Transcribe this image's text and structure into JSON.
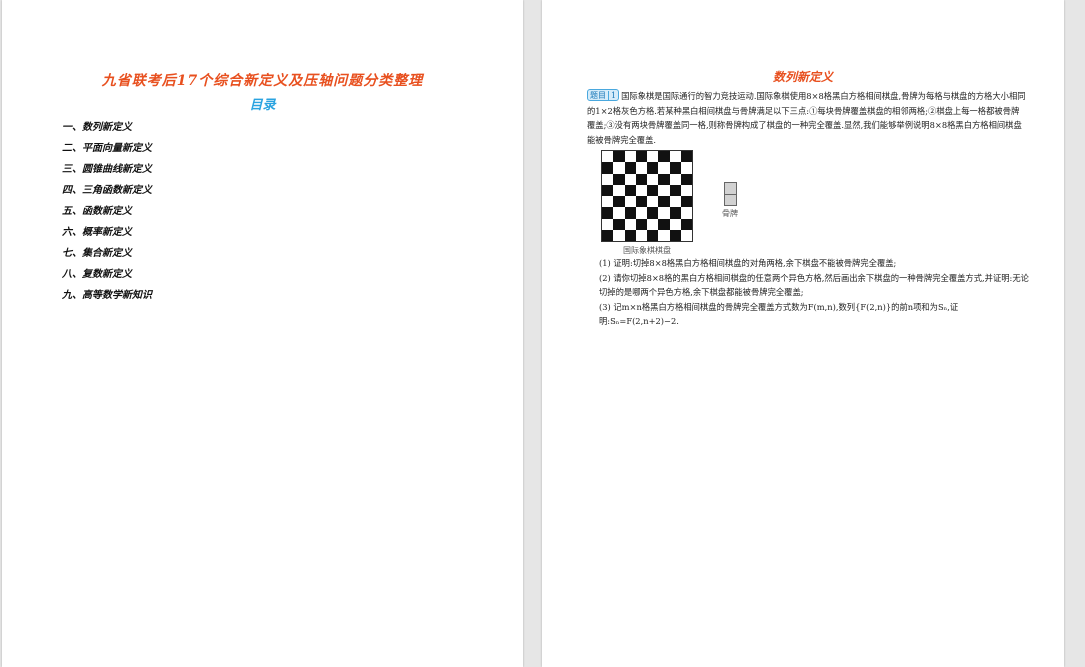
{
  "left_page": {
    "title": "九省联考后17个综合新定义及压轴问题分类整理",
    "toc_heading": "目录",
    "toc_items": [
      "一、数列新定义",
      "二、平面向量新定义",
      "三、圆锥曲线新定义",
      "四、三角函数新定义",
      "五、函数新定义",
      "六、概率新定义",
      "七、集合新定义",
      "八、复数新定义",
      "九、高等数学新知识"
    ]
  },
  "right_page": {
    "section_title": "数列新定义",
    "badge_label": "题目",
    "badge_number": "1",
    "problem_text": "国际象棋是国际通行的智力竞技运动.国际象棋使用8×8格黑白方格相间棋盘,骨牌为每格与棋盘的方格大小相同的1×2格灰色方格.若某种黑白相间棋盘与骨牌满足以下三点:①每块骨牌覆盖棋盘的相邻两格;②棋盘上每一格都被骨牌覆盖;③没有两块骨牌覆盖同一格,则称骨牌构成了棋盘的一种完全覆盖.显然,我们能够举例说明8×8格黑白方格相间棋盘能被骨牌完全覆盖.",
    "board_caption": "国际象棋棋盘",
    "domino_label": "骨牌",
    "questions": [
      "(1) 证明:切掉8×8格黑白方格相间棋盘的对角两格,余下棋盘不能被骨牌完全覆盖;",
      "(2) 请你切掉8×8格的黑白方格相间棋盘的任意两个异色方格,然后画出余下棋盘的一种骨牌完全覆盖方式,并证明:无论切掉的是哪两个异色方格,余下棋盘都能被骨牌完全覆盖;",
      "(3) 记m×n格黑白方格相间棋盘的骨牌完全覆盖方式数为F(m,n),数列{F(2,n)}的前n项和为Sₙ,证明:Sₙ=F(2,n+2)−2."
    ]
  },
  "colors": {
    "title_orange": "#e8501f",
    "heading_blue": "#2aa3e0",
    "badge_blue": "#4aa8de"
  }
}
